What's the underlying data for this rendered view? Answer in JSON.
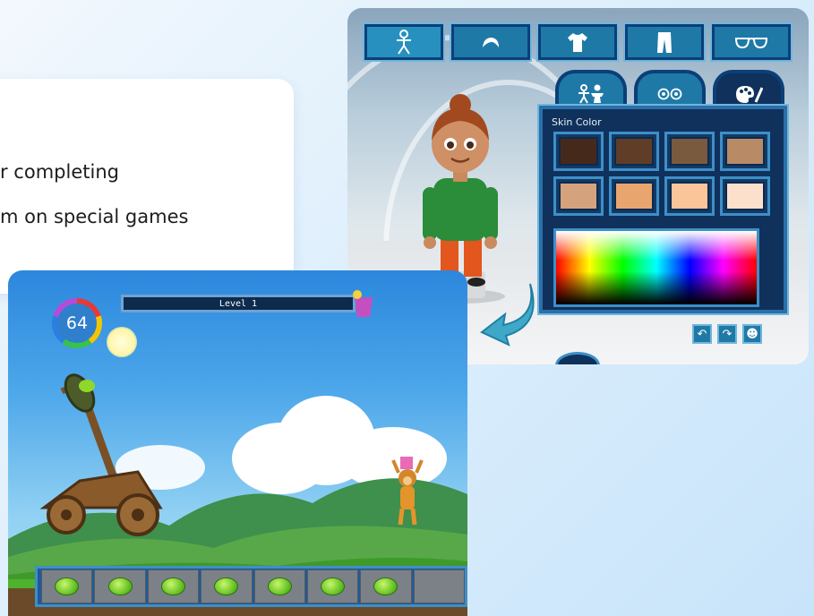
{
  "card": {
    "line1": "r completing",
    "line2": "m on special games"
  },
  "avatar_editor": {
    "toolbar": [
      {
        "icon": "body-icon",
        "active": true
      },
      {
        "icon": "hair-icon",
        "active": false
      },
      {
        "icon": "shirt-icon",
        "active": false
      },
      {
        "icon": "pants-icon",
        "active": false
      },
      {
        "icon": "glasses-icon",
        "active": false
      }
    ],
    "tabs": [
      {
        "icon": "people-icon",
        "active": false
      },
      {
        "icon": "eyes-icon",
        "active": false
      },
      {
        "icon": "palette-icon",
        "active": true
      }
    ],
    "skin_color_label": "Skin Color",
    "swatches": [
      "#45291b",
      "#5f3d26",
      "#7a5a3e",
      "#b98a66",
      "#d4a37e",
      "#e9a56e",
      "#f9c599",
      "#fde0cc"
    ],
    "buttons": [
      {
        "icon": "undo-icon",
        "glyph": "↶"
      },
      {
        "icon": "redo-icon",
        "glyph": "↷"
      },
      {
        "icon": "reset-avatar-icon",
        "glyph": "☻"
      }
    ]
  },
  "game": {
    "score": "64",
    "level": "Level 1",
    "lime_count": 7,
    "colors": {
      "accent": "#1f79a6",
      "panel": "#0f315c",
      "grass": "#3e9a2a"
    }
  }
}
